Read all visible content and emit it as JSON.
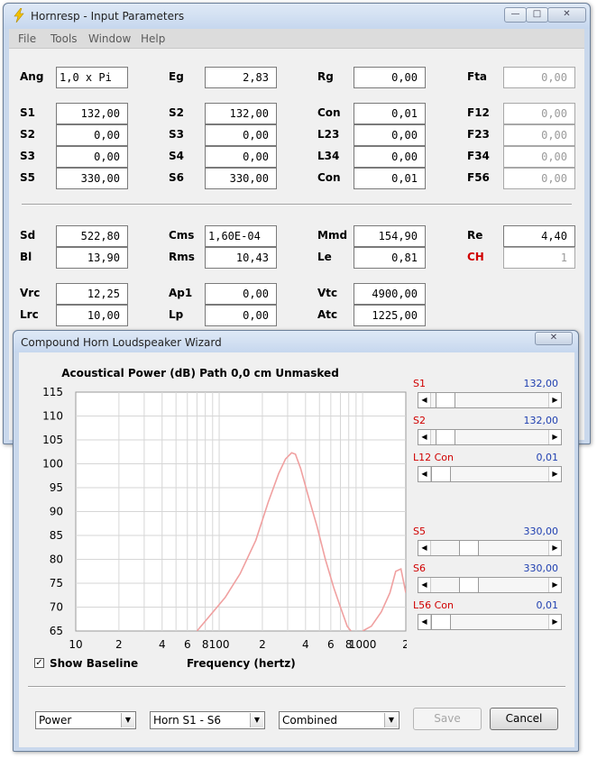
{
  "main": {
    "title": "Hornresp - Input Parameters",
    "menu": [
      "File",
      "Tools",
      "Window",
      "Help"
    ],
    "params": [
      {
        "label": "Ang",
        "value": "1,0 x Pi",
        "align": "left"
      },
      {
        "label": "Eg",
        "value": "2,83"
      },
      {
        "label": "Rg",
        "value": "0,00"
      },
      {
        "label": "Fta",
        "value": "0,00",
        "disabled": true
      },
      {
        "label": "S1",
        "value": "132,00"
      },
      {
        "label": "S2",
        "value": "132,00"
      },
      {
        "label": "Con",
        "value": "0,01"
      },
      {
        "label": "F12",
        "value": "0,00",
        "disabled": true
      },
      {
        "label": "S2",
        "value": "0,00"
      },
      {
        "label": "S3",
        "value": "0,00"
      },
      {
        "label": "L23",
        "value": "0,00"
      },
      {
        "label": "F23",
        "value": "0,00",
        "disabled": true
      },
      {
        "label": "S3",
        "value": "0,00"
      },
      {
        "label": "S4",
        "value": "0,00"
      },
      {
        "label": "L34",
        "value": "0,00"
      },
      {
        "label": "F34",
        "value": "0,00",
        "disabled": true
      },
      {
        "label": "S5",
        "value": "330,00"
      },
      {
        "label": "S6",
        "value": "330,00"
      },
      {
        "label": "Con",
        "value": "0,01"
      },
      {
        "label": "F56",
        "value": "0,00",
        "disabled": true
      },
      {
        "label": "Sd",
        "value": "522,80"
      },
      {
        "label": "Cms",
        "value": "1,60E-04",
        "align": "left"
      },
      {
        "label": "Mmd",
        "value": "154,90"
      },
      {
        "label": "Re",
        "value": "4,40"
      },
      {
        "label": "Bl",
        "value": "13,90"
      },
      {
        "label": "Rms",
        "value": "10,43"
      },
      {
        "label": "Le",
        "value": "0,81"
      },
      {
        "label": "CH",
        "value": "1",
        "red": true,
        "disabled": true
      },
      {
        "label": "Vrc",
        "value": "12,25"
      },
      {
        "label": "Ap1",
        "value": "0,00"
      },
      {
        "label": "Vtc",
        "value": "4900,00"
      },
      {
        "label": "Lrc",
        "value": "10,00"
      },
      {
        "label": "Lp",
        "value": "0,00"
      },
      {
        "label": "Atc",
        "value": "1225,00"
      }
    ]
  },
  "wizard": {
    "title": "Compound Horn Loudspeaker Wizard",
    "sliders": [
      {
        "label": "S1",
        "value": "132,00",
        "position": 0.05
      },
      {
        "label": "S2",
        "value": "132,00",
        "position": 0.05
      },
      {
        "label": "L12  Con",
        "value": "0,01",
        "position": 0.0
      },
      {
        "label": "S5",
        "value": "330,00",
        "position": 0.29
      },
      {
        "label": "S6",
        "value": "330,00",
        "position": 0.29
      },
      {
        "label": "L56  Con",
        "value": "0,01",
        "position": 0.0
      }
    ],
    "show_baseline": {
      "label": "Show Baseline",
      "checked": true
    },
    "combos": [
      "Power",
      "Horn S1 - S6",
      "Combined"
    ],
    "save_label": "Save",
    "cancel_label": "Cancel"
  },
  "chart_data": {
    "type": "line",
    "title": "Acoustical Power (dB)   Path 0,0 cm   Unmasked",
    "xlabel": "Frequency (hertz)",
    "ylabel": "",
    "x_scale": "log",
    "xlim": [
      10,
      2000
    ],
    "ylim": [
      65,
      115
    ],
    "y_ticks": [
      115,
      110,
      105,
      100,
      95,
      90,
      85,
      80,
      75,
      70,
      65
    ],
    "x_tick_labels": [
      {
        "x": 10,
        "label": "10"
      },
      {
        "x": 20,
        "label": "2"
      },
      {
        "x": 40,
        "label": "4"
      },
      {
        "x": 60,
        "label": "6"
      },
      {
        "x": 80,
        "label": "8"
      },
      {
        "x": 100,
        "label": "100"
      },
      {
        "x": 200,
        "label": "2"
      },
      {
        "x": 400,
        "label": "4"
      },
      {
        "x": 600,
        "label": "6"
      },
      {
        "x": 800,
        "label": "8"
      },
      {
        "x": 1000,
        "label": "1000"
      },
      {
        "x": 2000,
        "label": "2"
      }
    ],
    "grid": true,
    "series_color": "#f0a0a0",
    "series": [
      {
        "x": [
          70,
          85,
          110,
          140,
          180,
          220,
          260,
          290,
          320,
          340,
          370,
          420,
          480,
          550,
          630,
          700,
          780,
          830
        ],
        "y": [
          65,
          68,
          72,
          77,
          84,
          92,
          98,
          101,
          102.3,
          102,
          99,
          93,
          87,
          80,
          74,
          70,
          66,
          65
        ]
      },
      {
        "x": [
          1000,
          1150,
          1350,
          1550,
          1700,
          1850,
          2000
        ],
        "y": [
          65,
          66,
          69,
          73,
          77.5,
          78,
          73
        ]
      }
    ]
  }
}
